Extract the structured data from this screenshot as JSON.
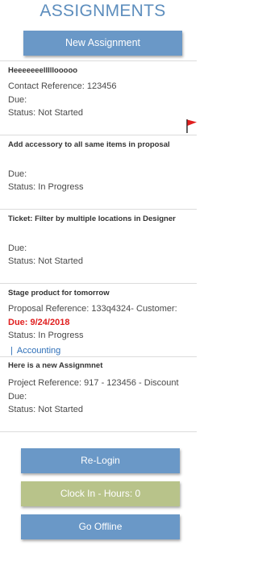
{
  "header": {
    "title": "ASSIGNMENTS"
  },
  "actions": {
    "new_assignment": "New Assignment"
  },
  "assignments": [
    {
      "title": "Heeeeeeelllllooooo",
      "reference": "Contact Reference: 123456",
      "due": "Due:",
      "status": "Status: Not Started",
      "flagged": true
    },
    {
      "title": "Add accessory to all same items in proposal",
      "due": "Due:",
      "status": "Status: In Progress"
    },
    {
      "title": "Ticket: Filter by multiple locations in Designer",
      "due": "Due:",
      "status": "Status: Not Started"
    },
    {
      "title": "Stage product for tomorrow",
      "reference": "Proposal Reference: 133q4324- Customer:",
      "due": "Due: 9/24/2018",
      "status": "Status: In Progress",
      "tag": "Accounting",
      "tag_separator": "|"
    },
    {
      "title": "Here is a new Assignmnet",
      "reference": "Project Reference: 917 - 123456 - Discount",
      "due": "Due:",
      "status": "Status: Not Started"
    }
  ],
  "footer": {
    "relogin": "Re-Login",
    "clock_in": "Clock In - Hours: 0",
    "go_offline": "Go Offline"
  },
  "colors": {
    "title": "#5c8dbd",
    "primary_button": "#6a98c7",
    "clock_button": "#b8c38a",
    "overdue_text": "#e01e1e",
    "tag_text": "#2e6fb8",
    "flag": "#e01e1e"
  },
  "icons": {
    "flag": "flag-icon"
  }
}
